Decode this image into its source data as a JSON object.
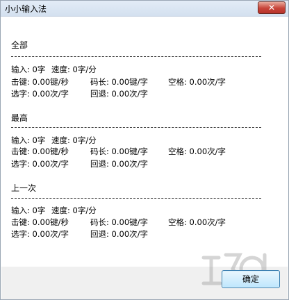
{
  "window": {
    "title": "小小输入法",
    "close_label": "✕"
  },
  "sections": [
    {
      "heading": "全部",
      "line1": {
        "input": "输入: 0字",
        "speed": "速度: 0字/分"
      },
      "line2": {
        "keystrokes": "击键: 0.00键/秒",
        "code_length": "码长: 0.00键/字",
        "space": "空格: 0.00次/字"
      },
      "line3": {
        "select": "选字: 0.00次/字",
        "backspace": "回退: 0.00次/字"
      }
    },
    {
      "heading": "最高",
      "line1": {
        "input": "输入: 0字",
        "speed": "速度: 0字/分"
      },
      "line2": {
        "keystrokes": "击键: 0.00键/秒",
        "code_length": "码长: 0.00键/字",
        "space": "空格: 0.00次/字"
      },
      "line3": {
        "select": "选字: 0.00次/字",
        "backspace": "回退: 0.00次/字"
      }
    },
    {
      "heading": "上一次",
      "line1": {
        "input": "输入: 0字",
        "speed": "速度: 0字/分"
      },
      "line2": {
        "keystrokes": "击键: 0.00键/秒",
        "code_length": "码长: 0.00键/字",
        "space": "空格: 0.00次/字"
      },
      "line3": {
        "select": "选字: 0.00次/字",
        "backspace": "回退: 0.00次/字"
      }
    }
  ],
  "footer": {
    "ok_label": "确定"
  }
}
